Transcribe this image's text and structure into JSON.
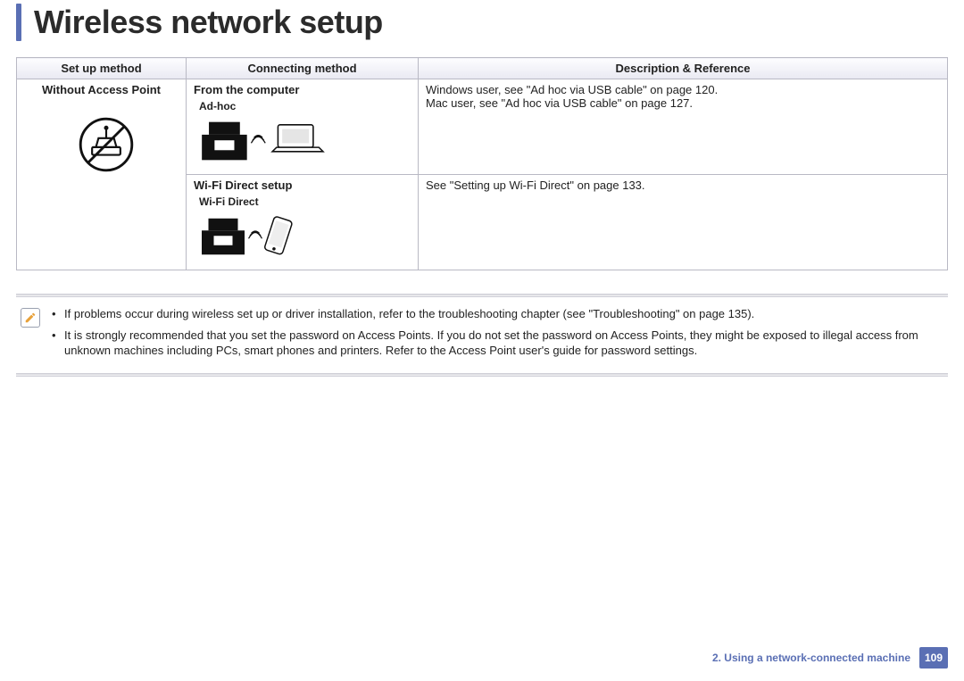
{
  "header": {
    "title": "Wireless network setup"
  },
  "table": {
    "headers": {
      "setup": "Set up method",
      "connecting": "Connecting method",
      "description": "Description & Reference"
    },
    "rows": {
      "setup_method": "Without Access Point",
      "row1": {
        "connecting_title": "From the computer",
        "illus_label": "Ad-hoc",
        "desc_line1": "Windows user, see \"Ad hoc via USB cable\" on page 120.",
        "desc_line2": "Mac user, see \"Ad hoc via USB cable\" on page 127."
      },
      "row2": {
        "connecting_title": "Wi-Fi Direct setup",
        "illus_label": "Wi-Fi Direct",
        "desc": "See \"Setting up Wi-Fi Direct\" on page 133."
      }
    }
  },
  "notes": {
    "item1": "If problems occur during wireless set up or driver installation, refer to the troubleshooting chapter (see \"Troubleshooting\" on page 135).",
    "item2": "It is strongly recommended that you set the password on Access Points. If you do not set the password on Access Points, they might be exposed to illegal access from unknown machines including PCs, smart phones and printers. Refer to the Access Point user's guide for password settings."
  },
  "footer": {
    "chapter": "2.  Using a network-connected machine",
    "page": "109"
  }
}
